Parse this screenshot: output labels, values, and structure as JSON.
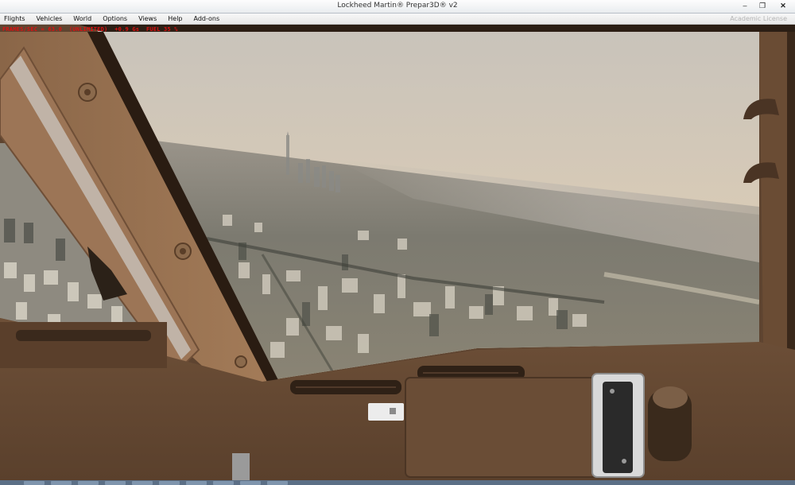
{
  "window": {
    "title": "Lockheed Martin® Prepar3D® v2",
    "minimize_glyph": "–",
    "maximize_glyph": "❐",
    "close_glyph": "✕"
  },
  "menu": {
    "items": [
      "Flights",
      "Vehicles",
      "World",
      "Options",
      "Views",
      "Help",
      "Add-ons"
    ],
    "license_text": "Academic License"
  },
  "hud": {
    "text": "FRAMES/SEC = 63.0  (UNLIMITED)  +0.9 Gs  FUEL 35 %"
  },
  "colors": {
    "hud_text": "#e01010",
    "cockpit_tan": "#7a5a40",
    "sky_top": "#c8c3bb",
    "sky_horizon": "#e8d4b4"
  }
}
